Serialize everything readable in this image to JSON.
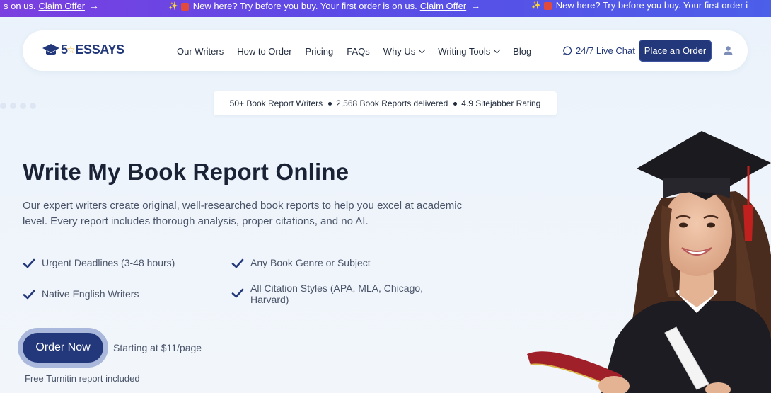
{
  "promo": {
    "lead_fragment": "s on us.",
    "message": "New here? Try before you buy. Your first order is on us.",
    "trailing_fragment": "New here? Try before you buy. Your first order i",
    "link": "Claim Offer",
    "arrow": "→",
    "sparkle": "✨"
  },
  "nav": {
    "logo_text": "ESSAYS",
    "logo_number": "5",
    "links": [
      "Our Writers",
      "How to Order",
      "Pricing",
      "FAQs",
      "Why Us",
      "Writing Tools",
      "Blog"
    ],
    "live_chat": "24/7 Live Chat",
    "place_order": "Place an Order"
  },
  "stats": {
    "items": [
      "50+ Book Report Writers",
      "2,568 Book Reports delivered",
      "4.9 Sitejabber Rating"
    ]
  },
  "hero": {
    "title": "Write My Book Report Online",
    "description": "Our expert writers create original, well-researched book reports to help you excel at academic level. Every report includes thorough analysis, proper citations, and no AI.",
    "features": [
      "Urgent Deadlines (3-48 hours)",
      "Any Book Genre or Subject",
      "Native English Writers",
      "All Citation Styles (APA, MLA, Chicago, Harvard)"
    ],
    "cta": "Order Now",
    "starting": "Starting at $11/page",
    "note": "Free Turnitin report included"
  },
  "colors": {
    "brand": "#22387a",
    "accent_star": "#f3b21b",
    "ticker_start": "#7b3fe0",
    "ticker_end": "#4c5fe9"
  },
  "icons": [
    "graduation-cap-icon",
    "chat-icon",
    "user-icon",
    "check-icon",
    "chevron-down-icon",
    "gift-icon",
    "arrow-right-icon"
  ]
}
